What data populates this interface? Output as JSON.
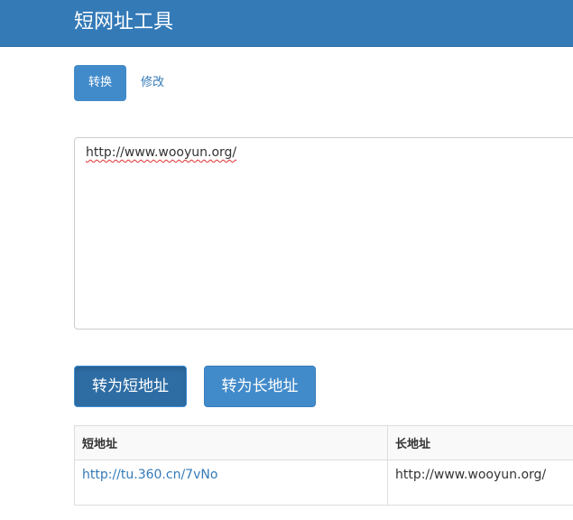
{
  "header": {
    "title": "短网址工具"
  },
  "tabs": [
    {
      "label": "转换",
      "active": true
    },
    {
      "label": "修改",
      "active": false
    }
  ],
  "input": {
    "value": "http://www.wooyun.org/"
  },
  "buttons": {
    "to_short": "转为短地址",
    "to_long": "转为长地址"
  },
  "table": {
    "headers": [
      "短地址",
      "长地址"
    ],
    "rows": [
      {
        "short": "http://tu.360.cn/7vNo",
        "long": "http://www.wooyun.org/"
      }
    ]
  },
  "colors": {
    "brand": "#337ab7",
    "primary_button": "#428bca",
    "primary_button_active": "#2e6da4",
    "link": "#337ab7"
  }
}
